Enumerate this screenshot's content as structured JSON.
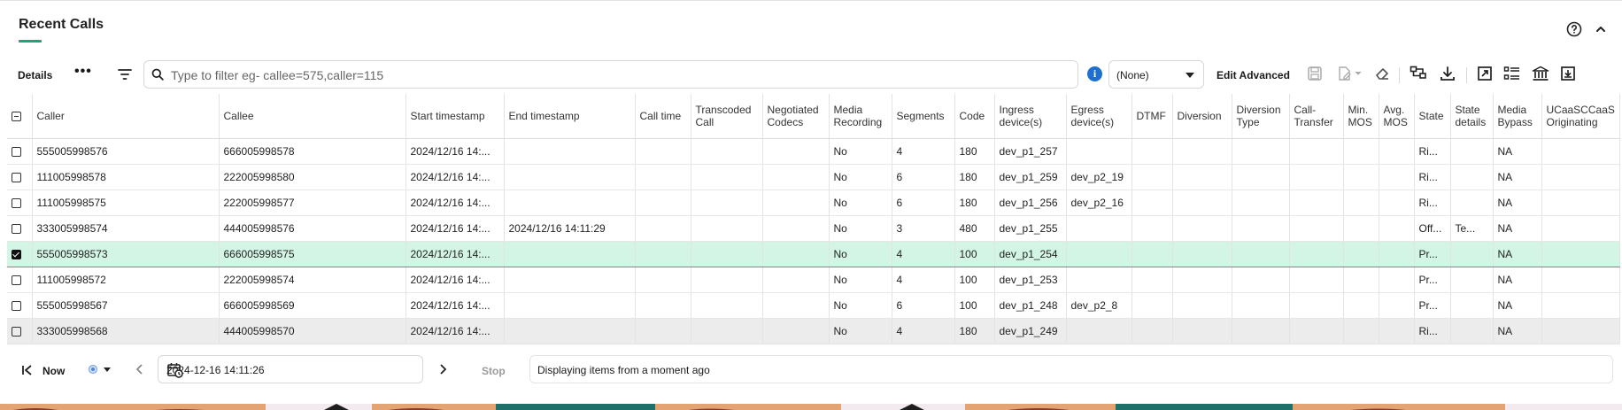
{
  "panel": {
    "title": "Recent Calls",
    "accent": "#15a878"
  },
  "header_icons": [
    "help-circle-icon",
    "chevron-up-icon"
  ],
  "toolbar": {
    "details_label": "Details",
    "more_label": "•••",
    "search_placeholder": "Type to filter eg- callee=575,caller=115",
    "search_value": "",
    "info_label": "i",
    "select_value": "(None)",
    "edit_advanced_label": "Edit Advanced",
    "icons": [
      "save-icon",
      "edit-file-icon",
      "eraser-icon",
      "tree-split-icon",
      "download-icon",
      "open-external-icon",
      "list-detail-icon",
      "bank-icon",
      "export-window-icon"
    ]
  },
  "table": {
    "columns": [
      "Caller",
      "Callee",
      "Start timestamp",
      "End timestamp",
      "Call time",
      "Transcoded Call",
      "Negotiated Codecs",
      "Media Recording",
      "Segments",
      "Code",
      "Ingress device(s)",
      "Egress device(s)",
      "DTMF",
      "Diversion",
      "Diversion Type",
      "Call-Transfer",
      "Min. MOS",
      "Avg. MOS",
      "State",
      "State details",
      "Media Bypass",
      "UCaaSCCaaS Originating"
    ],
    "rows": [
      {
        "checked": false,
        "state": "",
        "cells": [
          "555005998576",
          "666005998578",
          "2024/12/16 14:...",
          "",
          "",
          "",
          "",
          "No",
          "4",
          "180",
          "dev_p1_257",
          "",
          "",
          "",
          "",
          "",
          "",
          "",
          "Ri...",
          "",
          "NA",
          ""
        ]
      },
      {
        "checked": false,
        "state": "",
        "cells": [
          "111005998578",
          "222005998580",
          "2024/12/16 14:...",
          "",
          "",
          "",
          "",
          "No",
          "6",
          "180",
          "dev_p1_259",
          "dev_p2_19",
          "",
          "",
          "",
          "",
          "",
          "",
          "Ri...",
          "",
          "NA",
          ""
        ]
      },
      {
        "checked": false,
        "state": "",
        "cells": [
          "111005998575",
          "222005998577",
          "2024/12/16 14:...",
          "",
          "",
          "",
          "",
          "No",
          "6",
          "180",
          "dev_p1_256",
          "dev_p2_16",
          "",
          "",
          "",
          "",
          "",
          "",
          "Ri...",
          "",
          "NA",
          ""
        ]
      },
      {
        "checked": false,
        "state": "",
        "cells": [
          "333005998574",
          "444005998576",
          "2024/12/16 14:...",
          "2024/12/16 14:11:29",
          "",
          "",
          "",
          "No",
          "3",
          "480",
          "dev_p1_255",
          "",
          "",
          "",
          "",
          "",
          "",
          "",
          "Off...",
          "Te...",
          "NA",
          ""
        ]
      },
      {
        "checked": true,
        "state": "sel",
        "cells": [
          "555005998573",
          "666005998575",
          "2024/12/16 14:...",
          "",
          "",
          "",
          "",
          "No",
          "4",
          "100",
          "dev_p1_254",
          "",
          "",
          "",
          "",
          "",
          "",
          "",
          "Pr...",
          "",
          "NA",
          ""
        ]
      },
      {
        "checked": false,
        "state": "",
        "cells": [
          "111005998572",
          "222005998574",
          "2024/12/16 14:...",
          "",
          "",
          "",
          "",
          "No",
          "4",
          "100",
          "dev_p1_253",
          "",
          "",
          "",
          "",
          "",
          "",
          "",
          "Pr...",
          "",
          "NA",
          ""
        ]
      },
      {
        "checked": false,
        "state": "",
        "cells": [
          "555005998567",
          "666005998569",
          "2024/12/16 14:...",
          "",
          "",
          "",
          "",
          "No",
          "6",
          "100",
          "dev_p1_248",
          "dev_p2_8",
          "",
          "",
          "",
          "",
          "",
          "",
          "Pr...",
          "",
          "NA",
          ""
        ]
      },
      {
        "checked": false,
        "state": "hov",
        "cells": [
          "333005998568",
          "444005998570",
          "2024/12/16 14:...",
          "",
          "",
          "",
          "",
          "No",
          "4",
          "180",
          "dev_p1_249",
          "",
          "",
          "",
          "",
          "",
          "",
          "",
          "Ri...",
          "",
          "NA",
          ""
        ]
      }
    ]
  },
  "footer": {
    "now_label": "Now",
    "date_value": "2024-12-16 14:11:26",
    "stop_label": "Stop",
    "status_text": "Displaying items from a moment ago"
  },
  "colors": {
    "selected_row_bg": "#d3f5e6",
    "selected_row_border": "#2fb383",
    "info_blue": "#1f6fd1"
  }
}
